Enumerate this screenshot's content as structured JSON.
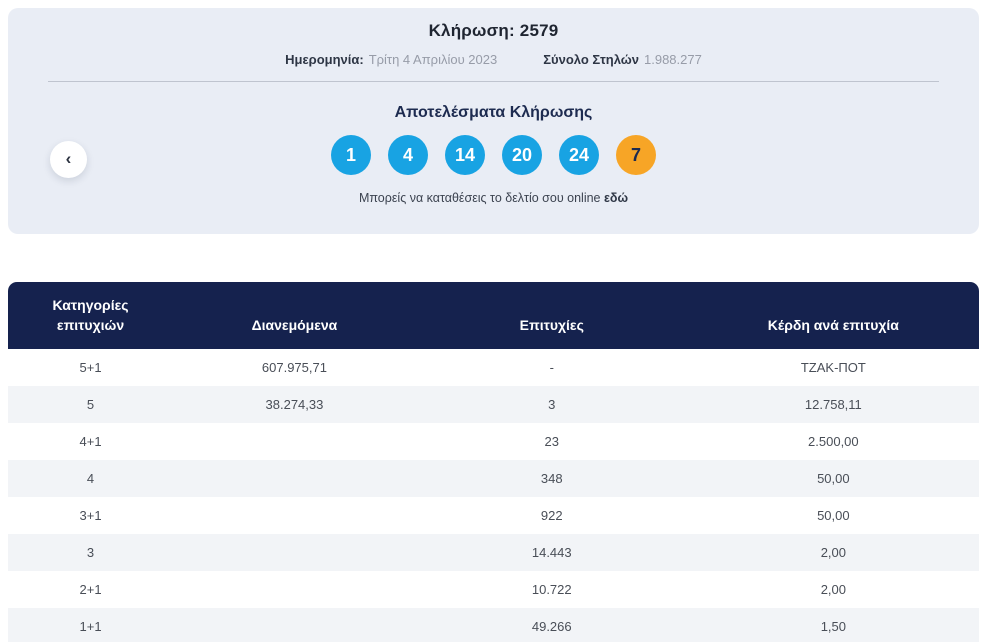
{
  "draw_card": {
    "title_label": "Κλήρωση:",
    "title_number": "2579",
    "date_label": "Ημερομηνία:",
    "date_value": "Τρίτη 4 Απριλίου 2023",
    "columns_label": "Σύνολο Στηλών",
    "columns_value": "1.988.277",
    "results_title": "Αποτελέσματα Κλήρωσης",
    "numbers": [
      {
        "value": "1",
        "type": "main"
      },
      {
        "value": "4",
        "type": "main"
      },
      {
        "value": "14",
        "type": "main"
      },
      {
        "value": "20",
        "type": "main"
      },
      {
        "value": "24",
        "type": "main"
      },
      {
        "value": "7",
        "type": "bonus"
      }
    ],
    "online_text": "Μπορείς να καταθέσεις το δελτίο σου online",
    "online_link_label": "εδώ",
    "prev_button_glyph": "‹"
  },
  "colors": {
    "card_background": "#e9edf5",
    "table_header_background": "#15224e",
    "main_ball": "#18a3e3",
    "bonus_ball": "#f7a526",
    "row_stripe": "#f2f4f7"
  },
  "table": {
    "headers": [
      "Κατηγορίες επιτυχιών",
      "Διανεμόμενα",
      "Επιτυχίες",
      "Κέρδη ανά επιτυχία"
    ],
    "rows": [
      {
        "category": "5+1",
        "distributed": "607.975,71",
        "winners": "-",
        "prize": "ΤΖΑΚ-ΠΟΤ"
      },
      {
        "category": "5",
        "distributed": "38.274,33",
        "winners": "3",
        "prize": "12.758,11"
      },
      {
        "category": "4+1",
        "distributed": "",
        "winners": "23",
        "prize": "2.500,00"
      },
      {
        "category": "4",
        "distributed": "",
        "winners": "348",
        "prize": "50,00"
      },
      {
        "category": "3+1",
        "distributed": "",
        "winners": "922",
        "prize": "50,00"
      },
      {
        "category": "3",
        "distributed": "",
        "winners": "14.443",
        "prize": "2,00"
      },
      {
        "category": "2+1",
        "distributed": "",
        "winners": "10.722",
        "prize": "2,00"
      },
      {
        "category": "1+1",
        "distributed": "",
        "winners": "49.266",
        "prize": "1,50"
      }
    ]
  }
}
